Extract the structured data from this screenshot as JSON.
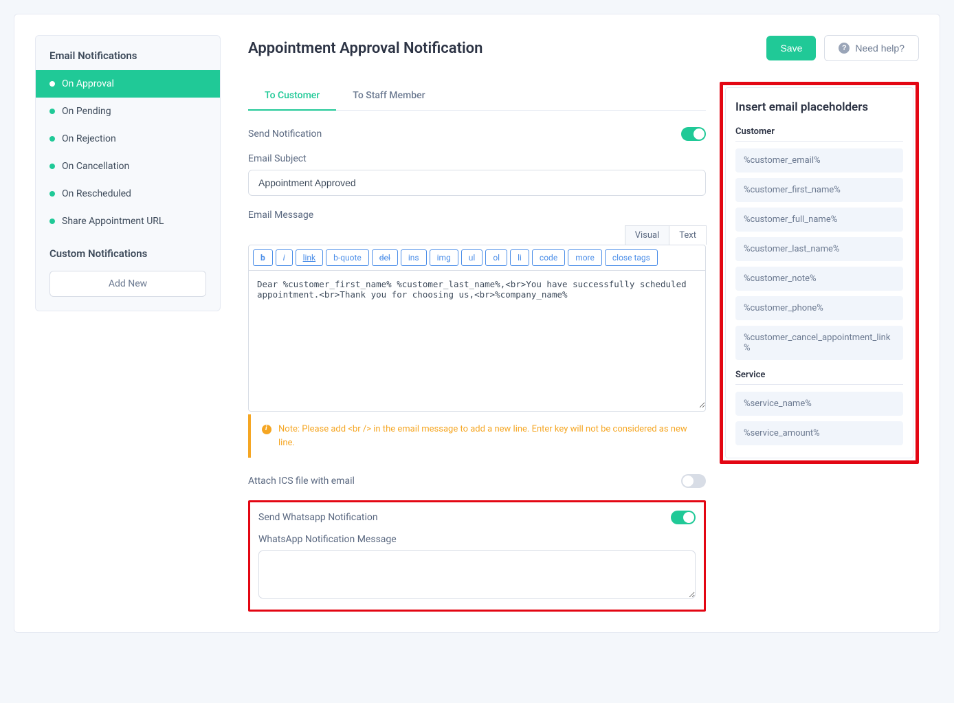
{
  "sidebar": {
    "title_email": "Email Notifications",
    "title_custom": "Custom Notifications",
    "add_new": "Add New",
    "items": [
      {
        "label": "On Approval",
        "active": true
      },
      {
        "label": "On Pending",
        "active": false
      },
      {
        "label": "On Rejection",
        "active": false
      },
      {
        "label": "On Cancellation",
        "active": false
      },
      {
        "label": "On Rescheduled",
        "active": false
      },
      {
        "label": "Share Appointment URL",
        "active": false
      }
    ]
  },
  "header": {
    "title": "Appointment Approval Notification",
    "save": "Save",
    "help": "Need help?"
  },
  "tabs": {
    "to_customer": "To Customer",
    "to_staff": "To Staff Member"
  },
  "form": {
    "send_notification_label": "Send Notification",
    "email_subject_label": "Email Subject",
    "email_subject_value": "Appointment Approved",
    "email_message_label": "Email Message",
    "email_message_value": "Dear %customer_first_name% %customer_last_name%,<br>You have successfully scheduled appointment.<br>Thank you for choosing us,<br>%company_name%",
    "note_text": "Note: Please add <br /> in the email message to add a new line. Enter key will not be considered as new line.",
    "attach_ics_label": "Attach ICS file with email",
    "send_whatsapp_label": "Send Whatsapp Notification",
    "whatsapp_message_label": "WhatsApp Notification Message",
    "whatsapp_message_value": ""
  },
  "editor": {
    "tab_visual": "Visual",
    "tab_text": "Text",
    "buttons": {
      "b": "b",
      "i": "i",
      "link": "link",
      "bquote": "b-quote",
      "del": "del",
      "ins": "ins",
      "img": "img",
      "ul": "ul",
      "ol": "ol",
      "li": "li",
      "code": "code",
      "more": "more",
      "close": "close tags"
    }
  },
  "placeholders": {
    "title": "Insert email placeholders",
    "group_customer": "Customer",
    "group_service": "Service",
    "customer_items": [
      "%customer_email%",
      "%customer_first_name%",
      "%customer_full_name%",
      "%customer_last_name%",
      "%customer_note%",
      "%customer_phone%",
      "%customer_cancel_appointment_link%"
    ],
    "service_items": [
      "%service_name%",
      "%service_amount%"
    ]
  }
}
